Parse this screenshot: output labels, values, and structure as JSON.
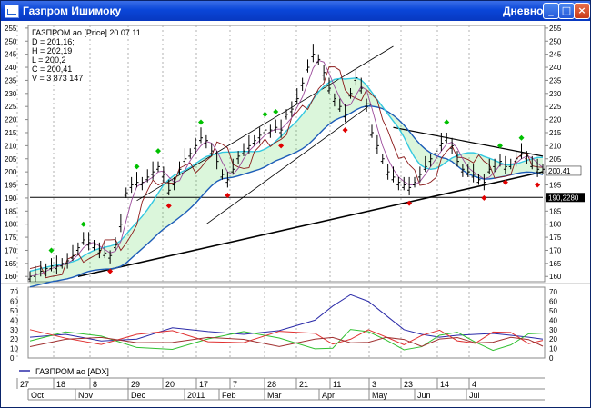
{
  "window": {
    "title": "Газпром Ишимоку",
    "timeframe": "Дневной",
    "buttons": {
      "minimize": "_",
      "maximize": "□",
      "close": "×"
    }
  },
  "price_panel": {
    "info_title": "ГАЗПРОМ ао [Price] 20.07.11",
    "info_lines": [
      "D = 201,16;",
      "H = 202,19",
      "L = 200,2",
      "C = 200,41",
      "V = 3 873 147"
    ],
    "y_ticks": [
      160,
      165,
      170,
      175,
      180,
      185,
      190,
      195,
      200,
      205,
      210,
      215,
      220,
      225,
      230,
      235,
      240,
      245,
      250,
      255
    ],
    "current_price_label": "200,41",
    "hline_label": "190,2280",
    "hline_value": 190.228
  },
  "adx_panel": {
    "legend": "ГАЗПРОМ ао [ADX]",
    "y_ticks": [
      0,
      10,
      20,
      30,
      40,
      50,
      60,
      70
    ]
  },
  "x_axis": {
    "day_labels": [
      "27",
      "18",
      "8",
      "29",
      "20",
      "17",
      "7",
      "28",
      "21",
      "11",
      "3",
      "23",
      "14",
      "4"
    ],
    "month_labels": [
      "Oct",
      "Nov",
      "Dec",
      "2011",
      "Feb",
      "Mar",
      "Apr",
      "May",
      "Jun",
      "Jul"
    ]
  },
  "colors": {
    "price": "#000000",
    "kijun": "#8b1a1a",
    "tenkan": "#9b4a9b",
    "senkou": "#33c8e0",
    "senkou_blue": "#1c5cb8",
    "cloud": "#10c010",
    "up_marker": "#00c000",
    "down_marker": "#e00000",
    "adx_blue": "#2a2aa8",
    "adx_red": "#e03030",
    "adx_green": "#30c030",
    "adx_brown": "#a03030"
  },
  "chart_data": [
    {
      "type": "line",
      "title": "ГАЗПРОМ ао [Price] 20.07.11",
      "ylim": [
        158,
        256
      ],
      "annotations": {
        "open": 201.16,
        "high": 202.19,
        "low": 200.2,
        "close": 200.41,
        "volume": "3 873 147",
        "horizontal_level": 190.228
      },
      "series": [
        {
          "name": "Price",
          "x": [
            0,
            6,
            12,
            18,
            24,
            30,
            36,
            42,
            48,
            54,
            60,
            66,
            72,
            78,
            84,
            90,
            96,
            102,
            108,
            114,
            120,
            126,
            132,
            138,
            144,
            150,
            156,
            162,
            168,
            174,
            180,
            186,
            192,
            198,
            204,
            210,
            216,
            222,
            228,
            234,
            240,
            246,
            252,
            258,
            264,
            270,
            276,
            282,
            288,
            294,
            300,
            306,
            312,
            318,
            324,
            330,
            336,
            342,
            348,
            354,
            360,
            366,
            372,
            378,
            384,
            390,
            396,
            402,
            408,
            414,
            420,
            426,
            432,
            438,
            444,
            450,
            456,
            462,
            468,
            474,
            480,
            486,
            492,
            498,
            504,
            510,
            516,
            522,
            528,
            534,
            540,
            546,
            552,
            558,
            564,
            570,
            576
          ],
          "values": [
            160,
            161,
            162,
            163,
            164,
            164,
            165,
            166,
            168,
            171,
            174,
            173,
            172,
            170,
            169,
            168,
            172,
            180,
            192,
            195,
            196,
            196,
            198,
            200,
            202,
            199,
            193,
            196,
            201,
            205,
            207,
            210,
            213,
            212,
            208,
            204,
            199,
            197,
            201,
            206,
            208,
            210,
            212,
            214,
            216,
            216,
            217,
            216,
            222,
            224,
            228,
            234,
            240,
            245,
            243,
            238,
            232,
            228,
            225,
            222,
            230,
            236,
            232,
            226,
            215,
            210,
            205,
            200,
            198,
            196,
            195,
            194,
            196,
            199,
            202,
            205,
            208,
            211,
            213,
            210,
            204,
            201,
            200,
            199,
            197,
            196,
            201,
            203,
            204,
            202,
            203,
            205,
            207,
            206,
            203,
            201,
            201
          ]
        }
      ]
    },
    {
      "type": "line",
      "title": "ГАЗПРОМ ао [ADX]",
      "ylim": [
        0,
        75
      ],
      "series": [
        {
          "name": "ГАЗПРОМ ао [ADX]",
          "x": [
            0,
            40,
            80,
            120,
            160,
            200,
            240,
            280,
            320,
            340,
            360,
            380,
            400,
            420,
            440,
            460,
            480,
            500,
            520,
            540,
            560,
            576
          ],
          "values": [
            22,
            25,
            18,
            20,
            32,
            28,
            25,
            29,
            40,
            55,
            67,
            60,
            45,
            30,
            25,
            22,
            24,
            25,
            26,
            24,
            22,
            20
          ]
        }
      ]
    }
  ]
}
